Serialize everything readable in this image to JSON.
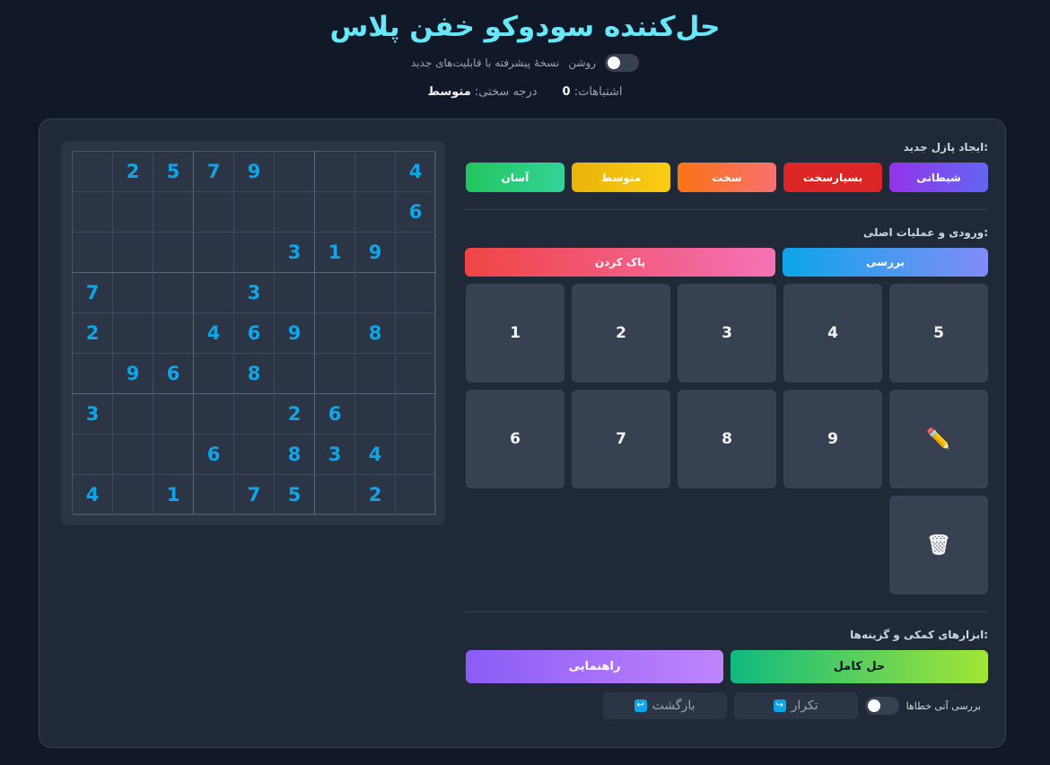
{
  "header": {
    "title": "حل‌کننده سودوکو خفن پلاس",
    "subtitle": "نسخهٔ پیشرفته با قابلیت‌های جدید",
    "theme_label": "روشن"
  },
  "stats": {
    "mistakes_label": "اشتباهات:",
    "mistakes_value": "0",
    "difficulty_label": "درجه سختی:",
    "difficulty_value": "متوسط"
  },
  "board": {
    "grid": [
      [
        "",
        "2",
        "5",
        "7",
        "9",
        "",
        "",
        "",
        "4"
      ],
      [
        "",
        "",
        "",
        "",
        "",
        "",
        "",
        "",
        "6"
      ],
      [
        "",
        "",
        "",
        "",
        "",
        "3",
        "1",
        "9",
        ""
      ],
      [
        "7",
        "",
        "",
        "",
        "3",
        "",
        "",
        "",
        ""
      ],
      [
        "2",
        "",
        "",
        "4",
        "6",
        "9",
        "",
        "8",
        ""
      ],
      [
        "",
        "9",
        "6",
        "",
        "8",
        "",
        "",
        "",
        ""
      ],
      [
        "3",
        "",
        "",
        "",
        "",
        "2",
        "6",
        "",
        ""
      ],
      [
        "",
        "",
        "",
        "6",
        "",
        "8",
        "3",
        "4",
        ""
      ],
      [
        "4",
        "",
        "1",
        "",
        "7",
        "5",
        "",
        "2",
        ""
      ]
    ]
  },
  "new_puzzle": {
    "title": ":ایجاد پازل جدید",
    "buttons": [
      {
        "label": "شیطانی",
        "name": "diff-devilish-button",
        "bg": "linear-gradient(90deg,#9333ea,#6366f1)"
      },
      {
        "label": "بسیارسخت",
        "name": "diff-very-hard-button",
        "bg": "#dc2626"
      },
      {
        "label": "سخت",
        "name": "diff-hard-button",
        "bg": "linear-gradient(90deg,#f97316,#f87171)"
      },
      {
        "label": "متوسط",
        "name": "diff-medium-button",
        "bg": "linear-gradient(90deg,#eab308,#facc15)"
      },
      {
        "label": "آسان",
        "name": "diff-easy-button",
        "bg": "linear-gradient(90deg,#22c55e,#34d399)"
      }
    ]
  },
  "input": {
    "title": ":ورودی و عملیات اصلی",
    "check_label": "بررسی",
    "clear_label": "پاک کردن",
    "keys": [
      "5",
      "4",
      "3",
      "2",
      "1",
      "✏️",
      "9",
      "8",
      "7",
      "6",
      "🗑"
    ]
  },
  "tools": {
    "title": ":ابزارهای کمکی و گزینه‌ها",
    "solve_label": "حل کامل",
    "hint_label": "راهنمایی",
    "live_check_label": "بررسی آنی خطاها",
    "redo_label": "تکرار",
    "undo_label": "بازگشت"
  },
  "colors": {
    "accent_title": "#67e8f9",
    "digit": "#0ea5e9",
    "background": "#111827",
    "card": "#1f2937"
  }
}
